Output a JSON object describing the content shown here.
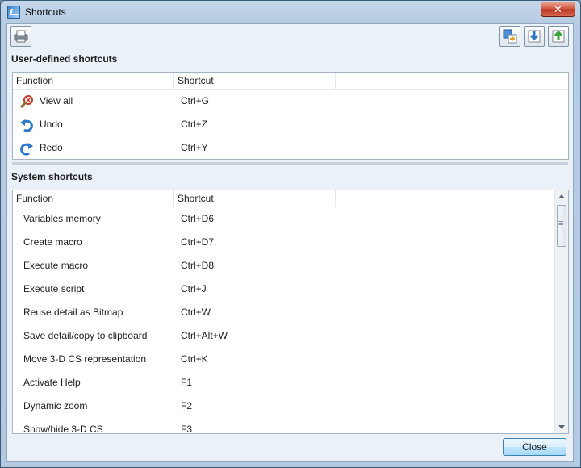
{
  "window": {
    "title": "Shortcuts",
    "close_glyph": "✕"
  },
  "toolbar": {
    "left_icon": "printer-icon",
    "right_icons": [
      "export-icon",
      "import-icon",
      "restore-icon"
    ]
  },
  "user_section": {
    "title": "User-defined shortcuts",
    "headers": {
      "function": "Function",
      "shortcut": "Shortcut"
    },
    "rows": [
      {
        "icon": "view-all-icon",
        "function": "View all",
        "shortcut": "Ctrl+G"
      },
      {
        "icon": "undo-icon",
        "function": "Undo",
        "shortcut": "Ctrl+Z"
      },
      {
        "icon": "redo-icon",
        "function": "Redo",
        "shortcut": "Ctrl+Y"
      }
    ]
  },
  "system_section": {
    "title": "System shortcuts",
    "headers": {
      "function": "Function",
      "shortcut": "Shortcut"
    },
    "rows": [
      {
        "function": "Variables memory",
        "shortcut": "Ctrl+D6"
      },
      {
        "function": "Create macro",
        "shortcut": "Ctrl+D7"
      },
      {
        "function": "Execute macro",
        "shortcut": "Ctrl+D8"
      },
      {
        "function": "Execute script",
        "shortcut": "Ctrl+J"
      },
      {
        "function": "Reuse detail as Bitmap",
        "shortcut": "Ctrl+W"
      },
      {
        "function": "Save detail/copy to clipboard",
        "shortcut": "Ctrl+Alt+W"
      },
      {
        "function": "Move 3-D CS representation",
        "shortcut": "Ctrl+K"
      },
      {
        "function": "Activate Help",
        "shortcut": "F1"
      },
      {
        "function": "Dynamic zoom",
        "shortcut": "F2"
      },
      {
        "function": "Show/hide 3-D CS",
        "shortcut": "F3"
      }
    ]
  },
  "footer": {
    "close_label": "Close"
  }
}
